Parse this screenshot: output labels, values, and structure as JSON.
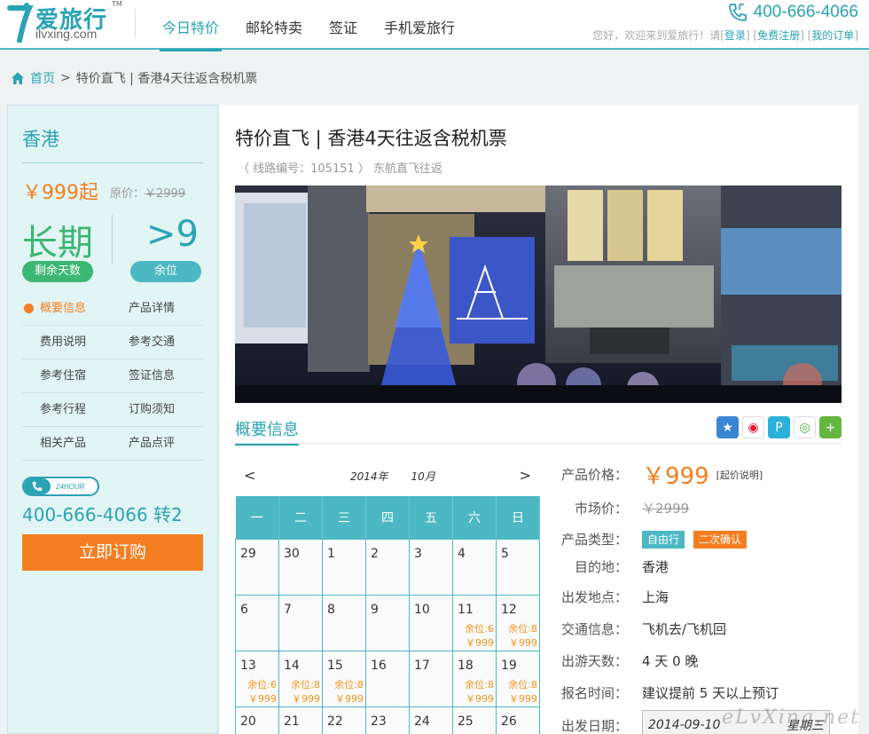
{
  "header": {
    "logo_cn": "爱旅行",
    "logo_en": "ilvxing.com",
    "logo_tm": "TM",
    "nav": [
      "今日特价",
      "邮轮特卖",
      "签证",
      "手机爱旅行"
    ],
    "hotline": "400-666-4066",
    "welcome_prefix": "您好，欢迎来到爱旅行！请",
    "login": "登录",
    "register": "免费注册",
    "my_orders": "我的订单"
  },
  "breadcrumb": {
    "home": "首页",
    "sep": ">",
    "current": "特价直飞 | 香港4天往返含税机票"
  },
  "sidebar": {
    "city": "香港",
    "price": "￥999起",
    "orig_label": "原价：",
    "orig_value": "￥2999",
    "days_value": "长期",
    "days_label": "剩余天数",
    "seats_value": ">9",
    "seats_label": "余位",
    "menu": [
      [
        "概要信息",
        "产品详情"
      ],
      [
        "费用说明",
        "参考交通"
      ],
      [
        "参考住宿",
        "签证信息"
      ],
      [
        "参考行程",
        "订购须知"
      ],
      [
        "相关产品",
        "产品点评"
      ]
    ],
    "badge_24": "24HOUR",
    "phone": "400-666-4066 转2",
    "buy": "立即订购"
  },
  "main": {
    "title": "特价直飞 | 香港4天往返含税机票",
    "subtitle": "（ 线路编号：105151 ）  东航直飞往返",
    "tab": "概要信息"
  },
  "calendar": {
    "prev": "<",
    "next": ">",
    "year": "2014年",
    "month": "10月",
    "weekdays": [
      "一",
      "二",
      "三",
      "四",
      "五",
      "六",
      "日"
    ],
    "weeks": [
      [
        {
          "d": "29"
        },
        {
          "d": "30"
        },
        {
          "d": "1"
        },
        {
          "d": "2"
        },
        {
          "d": "3"
        },
        {
          "d": "4"
        },
        {
          "d": "5"
        }
      ],
      [
        {
          "d": "6"
        },
        {
          "d": "7"
        },
        {
          "d": "8"
        },
        {
          "d": "9"
        },
        {
          "d": "10"
        },
        {
          "d": "11",
          "s": "余位:6",
          "p": "￥999"
        },
        {
          "d": "12",
          "s": "余位:8",
          "p": "￥999"
        }
      ],
      [
        {
          "d": "13",
          "s": "余位:6",
          "p": "￥999"
        },
        {
          "d": "14",
          "s": "余位:8",
          "p": "￥999"
        },
        {
          "d": "15",
          "s": "余位:8",
          "p": "￥999"
        },
        {
          "d": "16"
        },
        {
          "d": "17"
        },
        {
          "d": "18",
          "s": "余位:8",
          "p": "￥999"
        },
        {
          "d": "19",
          "s": "余位:8",
          "p": "￥999"
        }
      ],
      [
        {
          "d": "20"
        },
        {
          "d": "21"
        },
        {
          "d": "22"
        },
        {
          "d": "23"
        },
        {
          "d": "24"
        },
        {
          "d": "25"
        },
        {
          "d": "26"
        }
      ]
    ]
  },
  "info": {
    "price_label": "产品价格：",
    "price_value": "￥999",
    "price_note": "[起价说明]",
    "market_label": "市场价：",
    "market_value": "￥2999",
    "type_label": "产品类型：",
    "type_tag1": "自由行",
    "type_tag2": "二次确认",
    "dest_label": "目的地：",
    "dest_value": "香港",
    "depart_label": "出发地点：",
    "depart_value": "上海",
    "traffic_label": "交通信息：",
    "traffic_value": "飞机去/飞机回",
    "days_label": "出游天数：",
    "days_value": "4 天 0 晚",
    "signup_label": "报名时间：",
    "signup_value": "建议提前 5 天以上预订",
    "date_label": "出发日期：",
    "date_value": "2014-09-10",
    "date_weekday": "星期三"
  },
  "watermark": "eLvXing.net",
  "colors": {
    "accent": "#2aa3b3",
    "orange": "#f57e20",
    "green": "#3cb673"
  }
}
